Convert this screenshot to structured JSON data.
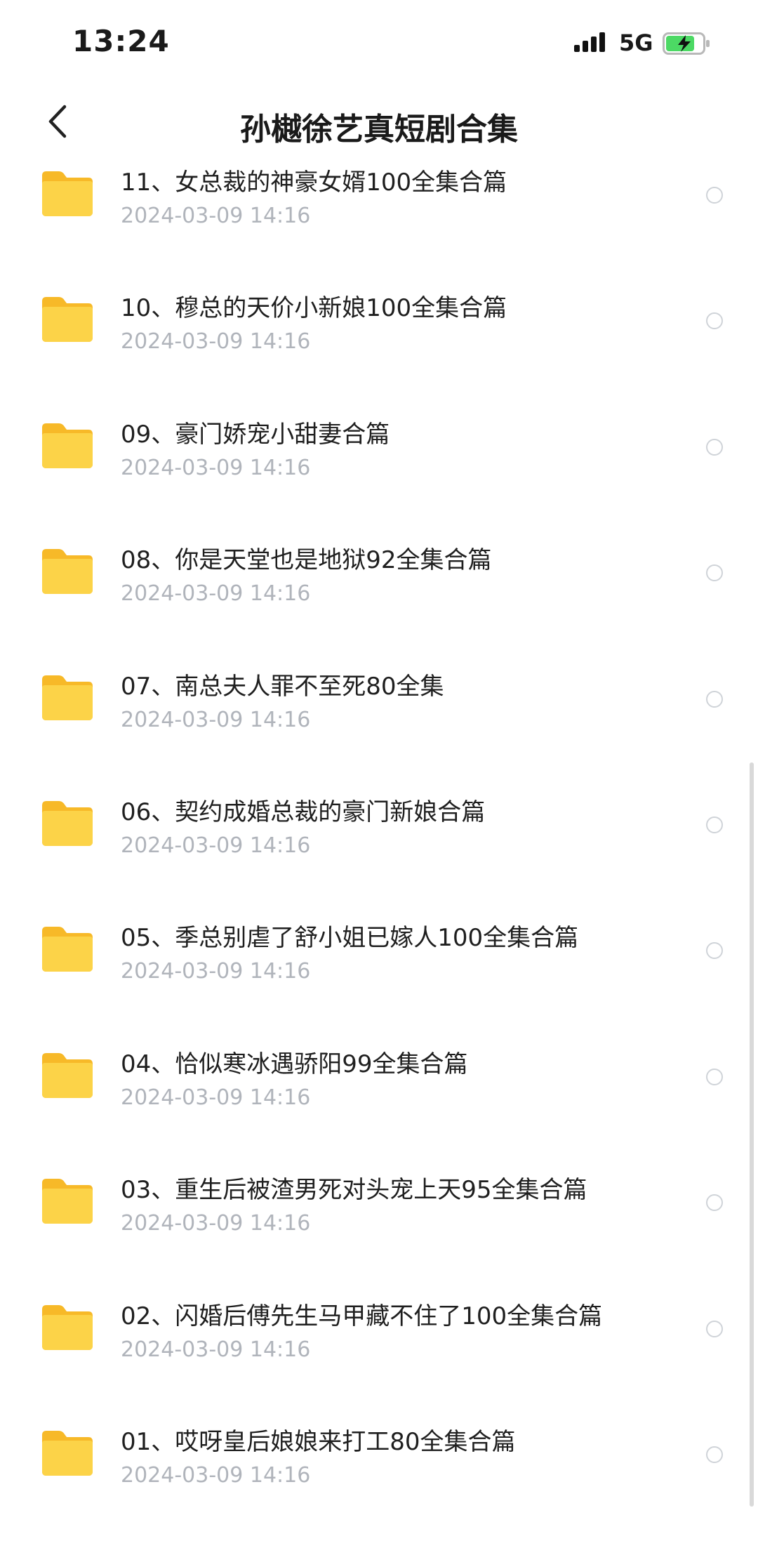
{
  "status": {
    "time": "13:24",
    "network": "5G"
  },
  "nav": {
    "title": "孙樾徐艺真短剧合集"
  },
  "items": [
    {
      "name": "11、女总裁的神豪女婿100全集合篇",
      "date": "2024-03-09 14:16"
    },
    {
      "name": "10、穆总的天价小新娘100全集合篇",
      "date": "2024-03-09 14:16"
    },
    {
      "name": "09、豪门娇宠小甜妻合篇",
      "date": "2024-03-09 14:16"
    },
    {
      "name": "08、你是天堂也是地狱92全集合篇",
      "date": "2024-03-09 14:16"
    },
    {
      "name": "07、南总夫人罪不至死80全集",
      "date": "2024-03-09 14:16"
    },
    {
      "name": "06、契约成婚总裁的豪门新娘合篇",
      "date": "2024-03-09 14:16"
    },
    {
      "name": "05、季总别虐了舒小姐已嫁人100全集合篇",
      "date": "2024-03-09 14:16"
    },
    {
      "name": "04、恰似寒冰遇骄阳99全集合篇",
      "date": "2024-03-09 14:16"
    },
    {
      "name": "03、重生后被渣男死对头宠上天95全集合篇",
      "date": "2024-03-09 14:16"
    },
    {
      "name": "02、闪婚后傅先生马甲藏不住了100全集合篇",
      "date": "2024-03-09 14:16"
    },
    {
      "name": "01、哎呀皇后娘娘来打工80全集合篇",
      "date": "2024-03-09 14:16"
    }
  ],
  "colors": {
    "folder": "#fbc83a",
    "battery": "#4cd964"
  }
}
